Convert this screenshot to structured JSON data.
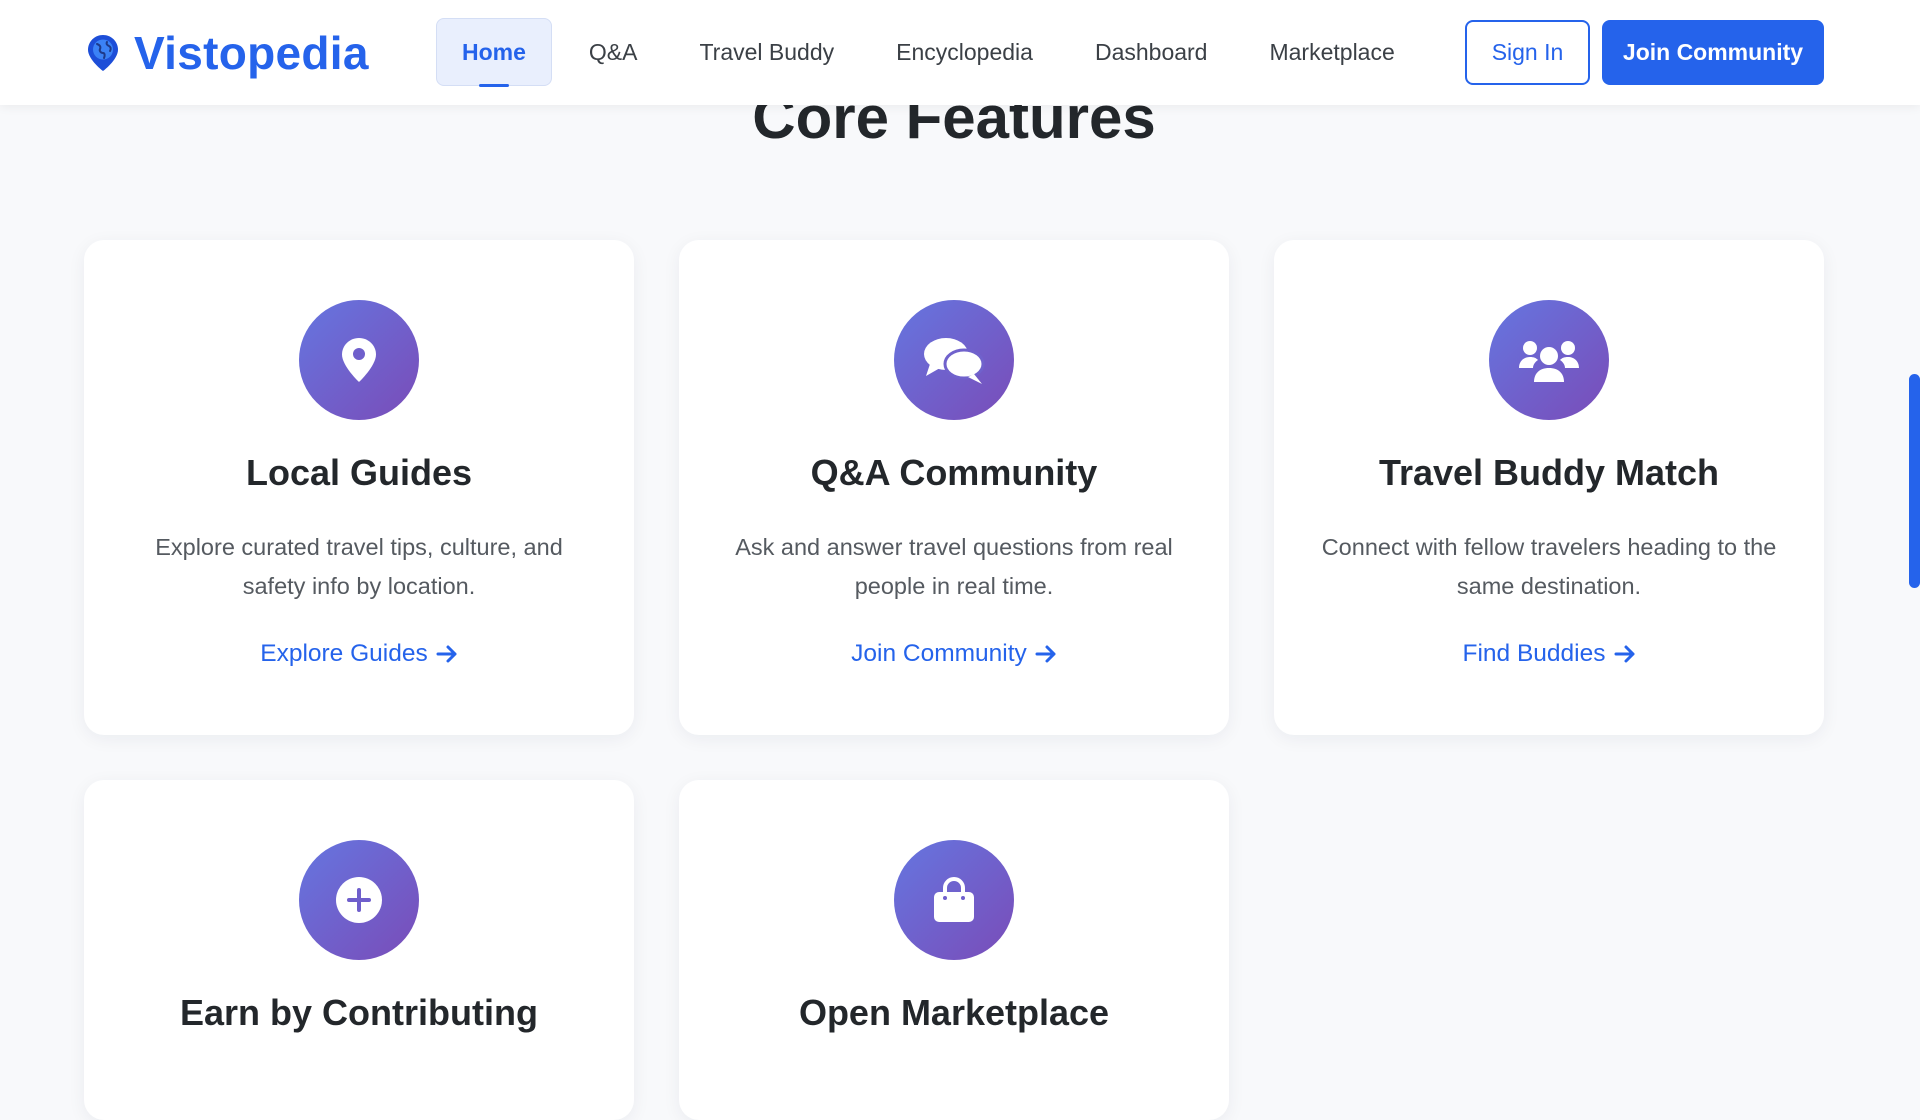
{
  "brand": {
    "name": "Vistopedia",
    "logo_icon": "globe-pin-icon"
  },
  "nav": {
    "items": [
      {
        "label": "Home",
        "active": true
      },
      {
        "label": "Q&A",
        "active": false
      },
      {
        "label": "Travel Buddy",
        "active": false
      },
      {
        "label": "Encyclopedia",
        "active": false
      },
      {
        "label": "Dashboard",
        "active": false
      },
      {
        "label": "Marketplace",
        "active": false
      }
    ],
    "sign_in": "Sign In",
    "join": "Join Community"
  },
  "section": {
    "title": "Core Features"
  },
  "cards": [
    {
      "icon": "map-pin-icon",
      "title": "Local Guides",
      "description": "Explore curated travel tips, culture, and safety info by location.",
      "link": "Explore Guides"
    },
    {
      "icon": "chat-bubbles-icon",
      "title": "Q&A Community",
      "description": "Ask and answer travel questions from real people in real time.",
      "link": "Join Community"
    },
    {
      "icon": "users-icon",
      "title": "Travel Buddy Match",
      "description": "Connect with fellow travelers heading to the same destination.",
      "link": "Find Buddies"
    },
    {
      "icon": "plus-circle-icon",
      "title": "Earn by Contributing",
      "description": "",
      "link": ""
    },
    {
      "icon": "shopping-bag-icon",
      "title": "Open Marketplace",
      "description": "",
      "link": ""
    }
  ],
  "colors": {
    "accent": "#2563eb",
    "icon_gradient_start": "#6576e0",
    "icon_gradient_end": "#7a4cb8",
    "page_background": "#f8f9fb"
  }
}
